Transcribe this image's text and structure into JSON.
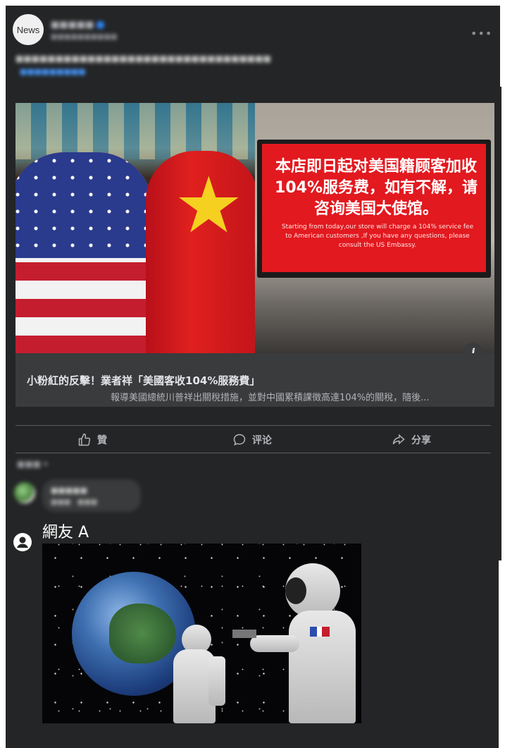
{
  "post": {
    "page_avatar_label": "News",
    "page_name": "■■■■■",
    "timestamp": "■■■■■■■■■■",
    "more_icon": "•••",
    "text_line1": "■■■■■■■■■■■■■■■■■■■■■■■■■■■■■■■■",
    "text_line2": "■■■■■■■■■"
  },
  "photo": {
    "sign_cn": "本店即日起对美国籍顾客加收104%服务费，如有不解，请咨询美国大使馆。",
    "sign_en": "Starting from today,our store will charge a 104% service fee to American customers ,If you have any questions, please consult the US Embassy.",
    "info_icon": "i"
  },
  "link": {
    "title": "小粉紅的反擊！業者祥「美國客收104%服務費」",
    "description": "報導美國總統川普祥出關稅措施，並對中國累積課徵高達104%的關稅，隨後..."
  },
  "actions": {
    "like": "贊",
    "comment": "评论",
    "share": "分享"
  },
  "comments": {
    "sort_label": "■■■ ▾",
    "first_name": "■■■■■",
    "first_meta": "■■■ · ■■■"
  },
  "netizen": {
    "label": "網友 A"
  }
}
